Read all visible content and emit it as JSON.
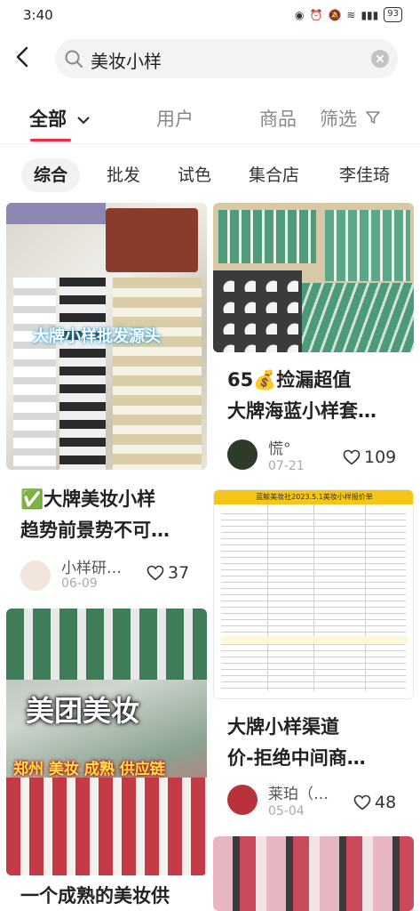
{
  "status_bar": {
    "time": "3:40",
    "battery": "93"
  },
  "search": {
    "query": "美妆小样"
  },
  "tabs": {
    "all": "全部",
    "users": "用户",
    "products": "商品",
    "filter": "筛选"
  },
  "chips": [
    "综合",
    "批发",
    "试色",
    "集合店",
    "李佳琦"
  ],
  "feed": {
    "left": [
      {
        "overlay": "大牌小样批发源头",
        "title_line1": "✅大牌美妆小样",
        "title_line2": "趋势前景势不可…",
        "author": "小样研…",
        "date": "06-09",
        "likes": "37"
      },
      {
        "overlay_main": "美团美妆",
        "overlay_sub": "郑州 美妆 成熟 供应链",
        "title_line1": "一个成熟的美妆供"
      }
    ],
    "right": [
      {
        "title_line1": "65💰捡漏超值",
        "title_line2": "大牌海蓝小样套…",
        "author": "慌°",
        "date": "07-21",
        "likes": "109"
      },
      {
        "sheet_title": "蓝鲸美妆社2023.5.1美妆小样报价单",
        "title_line1": "大牌小样渠道",
        "title_line2": "价-拒绝中间商…",
        "author": "莱珀（…",
        "date": "05-04",
        "likes": "48"
      }
    ]
  },
  "colors": {
    "accent": "#ff2442",
    "chip_bg": "#f2f2f2",
    "search_bg": "#f3f3f3"
  }
}
